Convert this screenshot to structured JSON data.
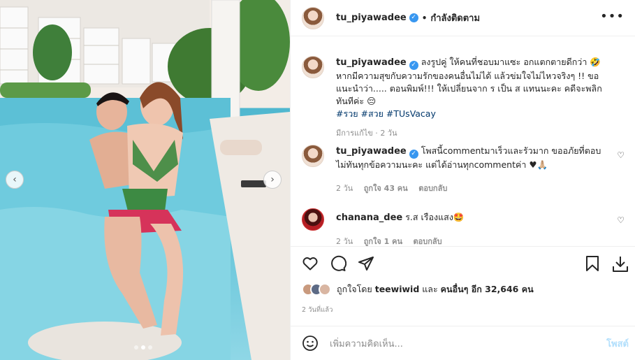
{
  "post": {
    "username": "tu_piyawadee",
    "follow_status": "กำลังติดตาม",
    "more_icon": "more-options-icon"
  },
  "caption": {
    "username": "tu_piyawadee",
    "text": "ลงรูปคู่ ให้คนที่ชอบมาแซะ อกแตกตายดีกว่า 🤣 หากมีความสุขกับความรักของคนอื่นไม่ได้ แล้วข่มใจไม่ไหวจริงๆ !! ขอแนะนำว่า..... ตอนพิมพ์!!! ให้เปลี่ยนจาก ร เป็น ส แทนนะคะ คดีจะพลิกทันทีค่ะ 😔",
    "hashtags": "#รวย #สวย #TUsVacay",
    "meta_edited": "มีการแก้ไข",
    "meta_time": "2 วัน"
  },
  "comments": [
    {
      "username": "tu_piyawadee",
      "text": "โพสนี้commentมาเร็วและรัวมาก ขออภัยที่ตอบไม่ทันทุกข้อความนะคะ แต่ได้อ่านทุกcommentค่า ♥🙏🏼",
      "time": "2 วัน",
      "likes": "ถูกใจ 43 คน",
      "reply": "ตอบกลับ"
    },
    {
      "username": "chanana_dee",
      "text": "ร.ส เรืองแสง🤩",
      "time": "2 วัน",
      "likes": "ถูกใจ 1 คน",
      "reply": "ตอบกลับ"
    }
  ],
  "likes": {
    "prefix": "ถูกใจโดย",
    "first_user": "teewiwid",
    "conj": "และ",
    "others": "คนอื่นๆ อีก 32,646 คน"
  },
  "time_ago": "2 วันที่แล้ว",
  "add_comment": {
    "placeholder": "เพิ่มความคิดเห็น...",
    "post_label": "โพสต์"
  },
  "carousel": {
    "slides": 3,
    "active_slide": 2
  }
}
